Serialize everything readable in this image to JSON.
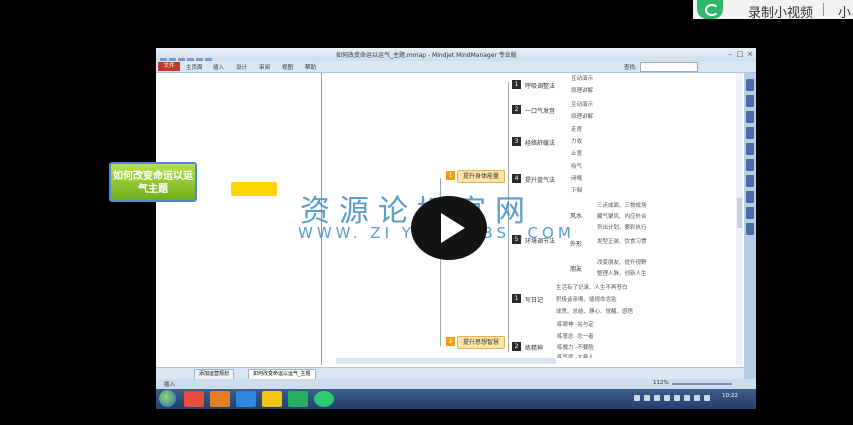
{
  "overlay": {
    "record_label": "录制小视频",
    "record_label_2": "小"
  },
  "window": {
    "title": "如何改变命运以运气_主题.mmap - Mindjet MindManager 专业版",
    "ribbon_tabs": [
      "文件",
      "主页面",
      "插入",
      "设计",
      "审阅",
      "视图",
      "帮助"
    ],
    "find_label": "查找:",
    "controls": [
      "–",
      "□",
      "×"
    ]
  },
  "sheets": [
    {
      "label": "添加运营规划",
      "active": false
    },
    {
      "label": "如何改变命运以运气_主题",
      "active": true
    }
  ],
  "status": {
    "left_text": "插入",
    "zoom": "112%",
    "clock": "10:22"
  },
  "mindmap": {
    "central_title": "如何改变命运以运气主题",
    "main_branches": [
      {
        "num": "1",
        "label": "提升身体能量"
      },
      {
        "num": "2",
        "label": "提升思想智慧"
      }
    ],
    "topics": [
      {
        "num": "1",
        "label": "呼吸调整法",
        "leaves": [
          "互动演示",
          "原理讲解"
        ]
      },
      {
        "num": "2",
        "label": "一口气发音",
        "leaves": [
          "互动演示",
          "原理讲解"
        ]
      },
      {
        "num": "3",
        "label": "经络舒缓法",
        "leaves": [
          "走肾",
          "力收",
          "止意"
        ]
      },
      {
        "num": "4",
        "label": "提升蓝气法",
        "leaves": [
          "吸气",
          "闭嘴",
          "下咽"
        ]
      },
      {
        "num": "5",
        "label": "环境调节法",
        "sub": [
          {
            "label": "风水",
            "leaves": [
              "三点成面、三物成场",
              "藏气聚风、内应外合",
              "列出计划、要彩执行"
            ]
          },
          {
            "label": "外形",
            "leaves": [
              "发型正装、饮食习惯"
            ]
          },
          {
            "label": "朋友",
            "leaves": [
              "改变朋友、提升视野",
              "整理人脉、创新人生"
            ]
          }
        ]
      },
      {
        "num": "1",
        "label": "写日记",
        "leaves": [
          "生活有了记录、人生不再苍白",
          "积极谈亲嘴、插视命念贴",
          "成思、总结、静心、觉醒、感悟"
        ]
      },
      {
        "num": "2",
        "label": "练精神",
        "leaves": [
          "练眼神  -站与定",
          "练意念  -念一者",
          "练魄力  -不要脸",
          "练气度  -大量人"
        ]
      }
    ]
  },
  "watermark": {
    "title": "资源论坛官网",
    "url": "WWW. ZI YUAN BBS .COM"
  }
}
